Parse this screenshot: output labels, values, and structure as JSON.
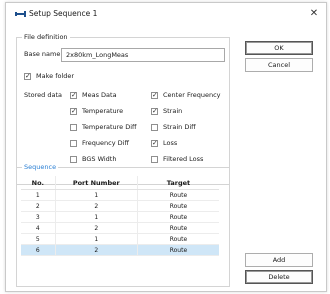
{
  "window": {
    "title": "Setup Sequence 1"
  },
  "file_definition": {
    "legend": "File definition",
    "base_name_label": "Base name",
    "base_name_value": "2x80km_LongMeas",
    "make_folder_label": "Make folder",
    "make_folder_checked": true,
    "stored_data_label": "Stored data",
    "options": [
      {
        "label": "Meas Data",
        "checked": true
      },
      {
        "label": "Center Frequency",
        "checked": true
      },
      {
        "label": "Temperature",
        "checked": true
      },
      {
        "label": "Strain",
        "checked": true
      },
      {
        "label": "Temperature Diff",
        "checked": false
      },
      {
        "label": "Strain Diff",
        "checked": false
      },
      {
        "label": "Frequency Diff",
        "checked": false
      },
      {
        "label": "Loss",
        "checked": true
      },
      {
        "label": "BGS Width",
        "checked": false
      },
      {
        "label": "Filtered Loss",
        "checked": false
      }
    ]
  },
  "buttons": {
    "ok": "OK",
    "cancel": "Cancel",
    "add": "Add",
    "delete": "Delete"
  },
  "sequence": {
    "legend": "Sequence",
    "columns": [
      "No.",
      "Port Number",
      "Target"
    ],
    "rows": [
      [
        "1",
        "1",
        "Route"
      ],
      [
        "2",
        "2",
        "Route"
      ],
      [
        "3",
        "1",
        "Route"
      ],
      [
        "4",
        "2",
        "Route"
      ],
      [
        "5",
        "1",
        "Route"
      ],
      [
        "6",
        "2",
        "Route"
      ]
    ],
    "selected_row": 5
  }
}
